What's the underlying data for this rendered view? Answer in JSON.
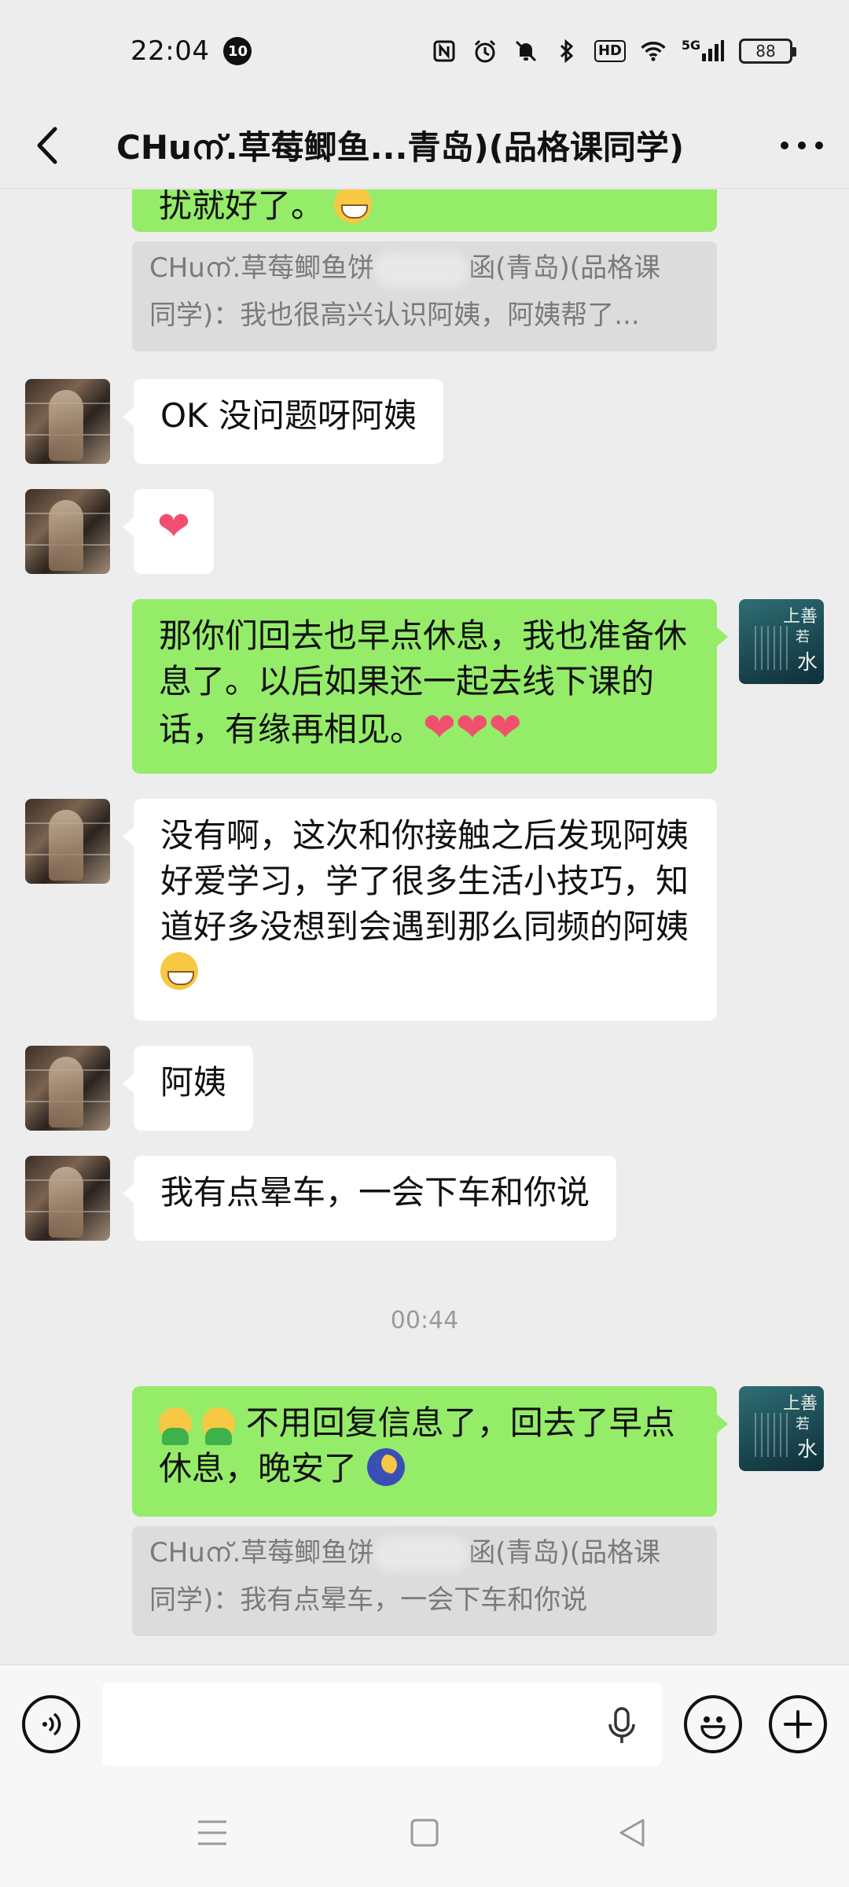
{
  "status_bar": {
    "time": "22:04",
    "notification_count": "10",
    "hd_label": "HD",
    "network_label": "5G",
    "battery": "88"
  },
  "header": {
    "title": "CHuന്.草莓鲫鱼...青岛)(品格课同学)"
  },
  "messages": {
    "m0_partial": "扰就好了。",
    "q1_line1_a": "CHuന്.草莓鲫鱼饼",
    "q1_line1_b": "函(青岛)(品格课",
    "q1_line2": "同学)：我也很高兴认识阿姨，阿姨帮了...",
    "m1": "OK 没问题呀阿姨",
    "m2_heart": "❤",
    "m3": "那你们回去也早点休息，我也准备休息了。以后如果还一起去线下课的话，有缘再相见。",
    "m3_hearts": "❤❤❤",
    "m4": "没有啊，这次和你接触之后发现阿姨好爱学习，学了很多生活小技巧，知道好多没想到会遇到那么同频的阿姨",
    "m5": "阿姨",
    "m6": "我有点晕车，一会下车和你说",
    "timestamp": "00:44",
    "m7": "不用回复信息了，回去了早点休息，晚安了",
    "q2_line1_a": "CHuന്.草莓鲫鱼饼",
    "q2_line1_b": "函(青岛)(品格课",
    "q2_line2": "同学)：我有点晕车，一会下车和你说"
  },
  "avatar_me": {
    "text_top": "上善",
    "text_mid": "若",
    "text_bottom": "水"
  },
  "colors": {
    "outgoing_bubble": "#95ec69",
    "incoming_bubble": "#ffffff",
    "background": "#ededed",
    "quote_background": "#dcdcdc"
  },
  "icons": {
    "back": "chevron-left-icon",
    "more": "more-dots-icon",
    "voice": "voice-input-icon",
    "mic": "microphone-icon",
    "emoji": "emoji-smile-icon",
    "plus": "plus-circle-icon",
    "nav_menu": "menu-lines-icon",
    "nav_home": "home-square-icon",
    "nav_back": "back-triangle-icon"
  }
}
